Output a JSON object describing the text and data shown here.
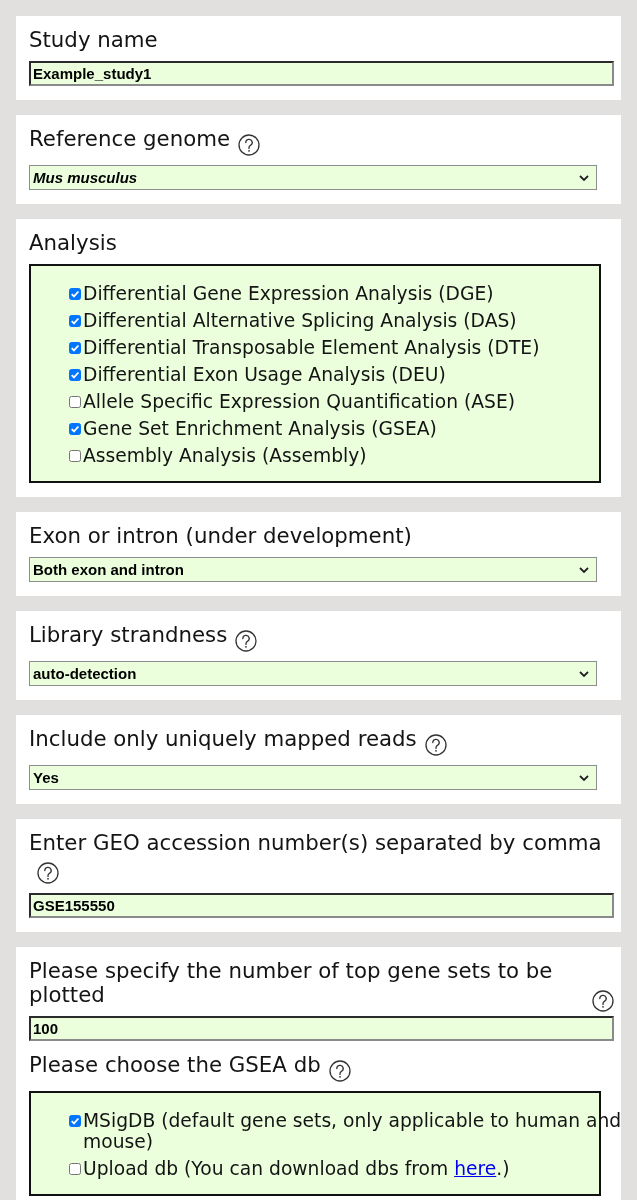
{
  "cards": [
    {
      "fields": [
        {
          "kind": "text_input",
          "title": "Study name",
          "help_icon": false,
          "value": "Example_study1"
        }
      ]
    },
    {
      "fields": [
        {
          "kind": "dropdown",
          "title": "Reference genome",
          "help_icon": true,
          "value": "Mus musculus",
          "italic": true
        }
      ]
    },
    {
      "fields": [
        {
          "kind": "checklist",
          "title": "Analysis",
          "help_icon": false,
          "options": [
            {
              "label": "Differential Gene Expression Analysis (DGE)",
              "checked": true
            },
            {
              "label": "Differential Alternative Splicing Analysis (DAS)",
              "checked": true
            },
            {
              "label": "Differential Transposable Element Analysis (DTE)",
              "checked": true
            },
            {
              "label": "Differential Exon Usage Analysis (DEU)",
              "checked": true
            },
            {
              "label": "Allele Specific Expression Quantification (ASE)",
              "checked": false
            },
            {
              "label": "Gene Set Enrichment Analysis (GSEA)",
              "checked": true
            },
            {
              "label": "Assembly Analysis (Assembly)",
              "checked": false
            }
          ]
        }
      ]
    },
    {
      "fields": [
        {
          "kind": "dropdown",
          "title": "Exon or intron (under development)",
          "help_icon": false,
          "value": "Both exon and intron",
          "italic": false
        }
      ]
    },
    {
      "fields": [
        {
          "kind": "dropdown",
          "title": "Library strandness",
          "help_icon": true,
          "value": "auto-detection",
          "italic": false
        }
      ]
    },
    {
      "fields": [
        {
          "kind": "dropdown",
          "title": "Include only uniquely mapped reads",
          "help_icon": true,
          "value": "Yes",
          "italic": false
        }
      ]
    },
    {
      "fields": [
        {
          "kind": "text_input",
          "title": "Enter GEO accession number(s) separated by comma",
          "help_icon": true,
          "value": "GSE155550"
        }
      ]
    },
    {
      "fields": [
        {
          "kind": "text_input",
          "title": "Please specify the number of top gene sets to be plotted",
          "help_icon": true,
          "value": "100"
        },
        {
          "kind": "checklist",
          "title": "Please choose the GSEA db",
          "help_icon": true,
          "options": [
            {
              "label": "MSigDB (default gene sets, only applicable to human and mouse)",
              "checked": true
            },
            {
              "label": "Upload db (You can download dbs from ",
              "link": "here",
              "label_after": ".)",
              "checked": false
            }
          ]
        }
      ]
    }
  ]
}
